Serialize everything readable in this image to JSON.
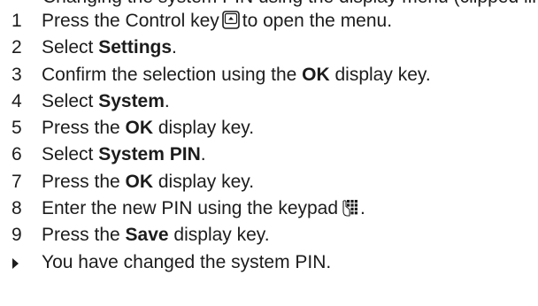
{
  "clipped_top_text": "Changing the system PIN using the display menu (clipped line)",
  "steps": [
    {
      "num": "1",
      "pre": "Press the Control key",
      "post": "to open the menu.",
      "icon": "control-key-icon"
    },
    {
      "num": "2",
      "pre": "Select ",
      "bold": "Settings",
      "post": "."
    },
    {
      "num": "3",
      "pre": "Confirm the selection using the ",
      "bold": "OK",
      "post": " display key."
    },
    {
      "num": "4",
      "pre": "Select ",
      "bold": "System",
      "post": "."
    },
    {
      "num": "5",
      "pre": "Press the ",
      "bold": "OK",
      "post": " display key."
    },
    {
      "num": "6",
      "pre": "Select ",
      "bold": "System PIN",
      "post": "."
    },
    {
      "num": "7",
      "pre": "Press the ",
      "bold": "OK",
      "post": " display key."
    },
    {
      "num": "8",
      "pre": "Enter the new PIN using the keypad",
      "post": ".",
      "icon": "keypad-icon"
    },
    {
      "num": "9",
      "pre": "Press the ",
      "bold": "Save",
      "post": " display key."
    }
  ],
  "result": {
    "text": "You have changed the system PIN."
  }
}
